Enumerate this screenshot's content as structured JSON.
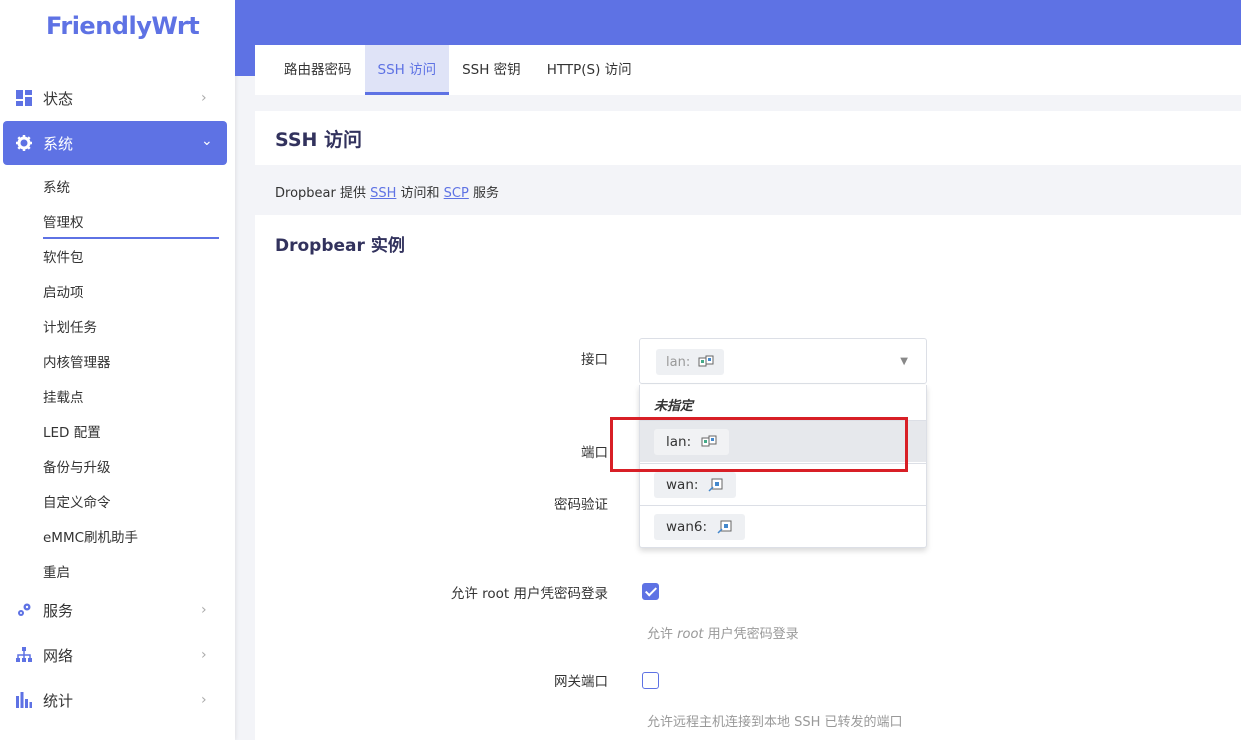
{
  "app": {
    "logo": "FriendlyWrt"
  },
  "sidebar": {
    "items": [
      {
        "label": "状态",
        "icon": "dashboard-icon"
      },
      {
        "label": "系统",
        "icon": "gear-icon",
        "active": true
      },
      {
        "label": "服务",
        "icon": "services-icon"
      },
      {
        "label": "网络",
        "icon": "network-icon"
      },
      {
        "label": "统计",
        "icon": "chart-icon"
      }
    ],
    "sub_items": [
      "系统",
      "管理权",
      "软件包",
      "启动项",
      "计划任务",
      "内核管理器",
      "挂载点",
      "LED 配置",
      "备份与升级",
      "自定义命令",
      "eMMC刷机助手",
      "重启"
    ],
    "current_sub": "管理权"
  },
  "tabs": [
    "路由器密码",
    "SSH 访问",
    "SSH 密钥",
    "HTTP(S) 访问"
  ],
  "active_tab": "SSH 访问",
  "page": {
    "title": "SSH 访问",
    "desc_prefix": "Dropbear 提供 ",
    "desc_link1": "SSH",
    "desc_mid": " 访问和 ",
    "desc_link2": "SCP",
    "desc_suffix": " 服务"
  },
  "section": {
    "title": "Dropbear 实例",
    "fields": {
      "interface_label": "接口",
      "port_label": "端口",
      "password_auth_label": "密码验证",
      "root_password_label": "允许 root 用户凭密码登录",
      "root_password_hint_prefix": "允许 ",
      "root_password_hint_em": "root",
      "root_password_hint_suffix": " 用户凭密码登录",
      "gateway_ports_label": "网关端口",
      "gateway_ports_hint": "允许远程主机连接到本地 SSH 已转发的端口"
    },
    "interface_select": {
      "selected": "lan:",
      "options": [
        "未指定",
        "lan:",
        "wan:",
        "wan6:"
      ],
      "hovered": "lan:"
    },
    "root_password_checked": true,
    "gateway_ports_checked": false
  },
  "colors": {
    "accent": "#5e72e4",
    "highlight": "#d81f26"
  }
}
